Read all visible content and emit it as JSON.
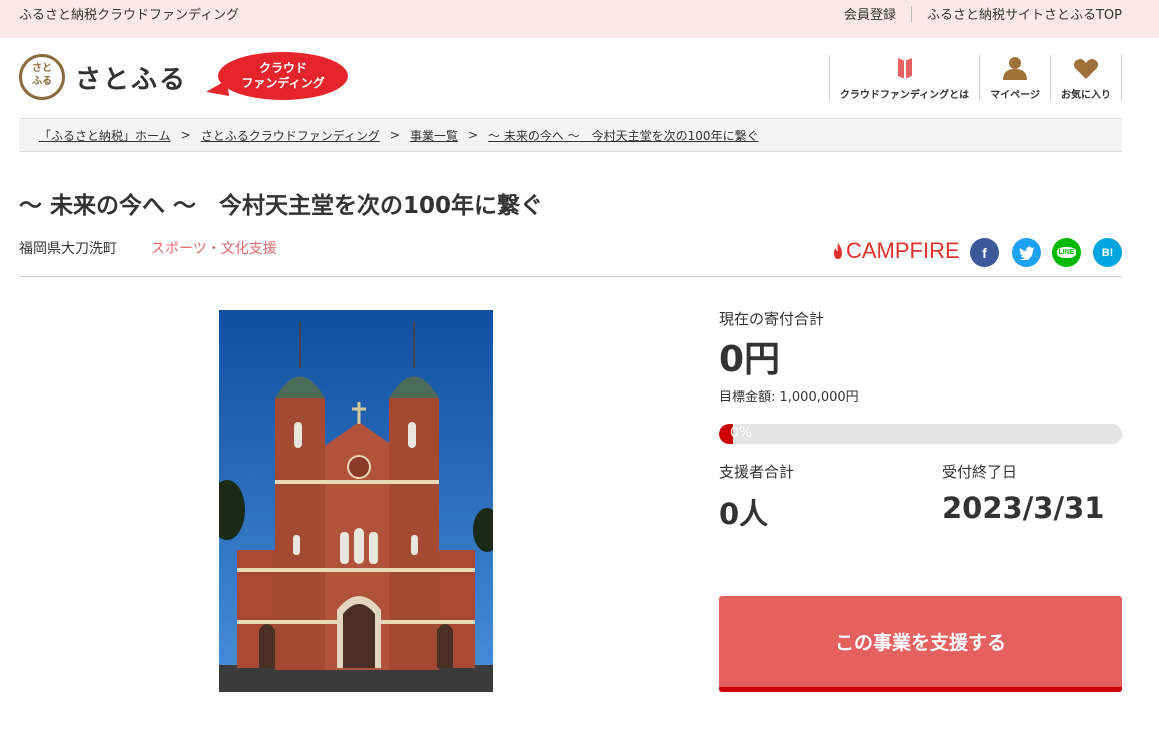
{
  "topbar": {
    "site_name": "ふるさと納税クラウドファンディング",
    "links": [
      "会員登録",
      "ふるさと納税サイトさとふるTOP"
    ]
  },
  "header": {
    "logo_text": "さとふる",
    "logo_seal": "さとふる",
    "badge_line1": "クラウド",
    "badge_line2": "ファンディング",
    "nav": [
      {
        "label": "クラウドファンディングとは",
        "icon": "book-icon"
      },
      {
        "label": "マイページ",
        "icon": "user-icon"
      },
      {
        "label": "お気に入り",
        "icon": "heart-icon"
      }
    ]
  },
  "breadcrumb": [
    "「ふるさと納税」ホーム",
    "さとふるクラウドファンディング",
    "事業一覧",
    "～ 未来の今へ ～　今村天主堂を次の100年に繋ぐ"
  ],
  "project": {
    "title": "～ 未来の今へ ～　今村天主堂を次の100年に繋ぐ",
    "location": "福岡県大刀洗町",
    "category": "スポーツ・文化支援",
    "platform": "CAMPFIRE"
  },
  "social": [
    {
      "name": "facebook",
      "glyph": "f",
      "color": "#3b5998"
    },
    {
      "name": "twitter",
      "glyph": "t",
      "color": "#1da1f2"
    },
    {
      "name": "line",
      "glyph": "LINE",
      "color": "#00b900"
    },
    {
      "name": "hatena",
      "glyph": "B!",
      "color": "#00a4de"
    }
  ],
  "stats": {
    "total_label": "現在の寄付合計",
    "total_value": "0円",
    "goal_text": "目標金額: 1,000,000円",
    "progress_text": "0%",
    "progress_fraction": 0,
    "supporters_label": "支援者合計",
    "supporters_value": "0人",
    "deadline_label": "受付終了日",
    "deadline_value": "2023/3/31"
  },
  "support_button": "この事業を支援する",
  "colors": {
    "accent": "#e5615f",
    "topbar_bg": "#fbe9ea",
    "category": "#e06b6f",
    "campfire": "#e0312c",
    "progress_fill": "#cc0000"
  }
}
